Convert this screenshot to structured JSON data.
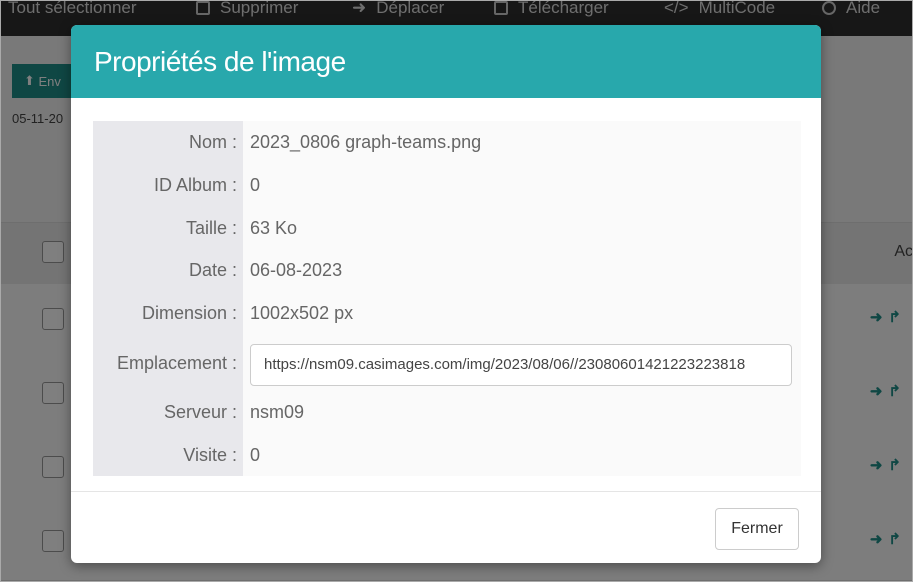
{
  "background": {
    "toolbar": [
      {
        "label": "Tout sélectionner",
        "icon": "check-square-icon"
      },
      {
        "label": "Supprimer",
        "icon": "trash-icon"
      },
      {
        "label": "Déplacer",
        "icon": "arrow-right-icon"
      },
      {
        "label": "Télécharger",
        "icon": "download-icon"
      },
      {
        "label": "MultiCode",
        "icon": "code-icon"
      },
      {
        "label": "Aide",
        "icon": "help-icon"
      }
    ],
    "upload_label": "Env",
    "date_text": "05-11-20",
    "actions_header": "Ac"
  },
  "modal": {
    "title": "Propriétés de l'image",
    "fields": {
      "nom": {
        "label": "Nom :",
        "value": "2023_0806 graph-teams.png"
      },
      "album": {
        "label": "ID Album :",
        "value": "0"
      },
      "taille": {
        "label": "Taille :",
        "value": "63 Ko"
      },
      "date": {
        "label": "Date :",
        "value": "06-08-2023"
      },
      "dimension": {
        "label": "Dimension :",
        "value": "1002x502 px"
      },
      "emplacement": {
        "label": "Emplacement :",
        "value": "https://nsm09.casimages.com/img/2023/08/06//23080601421223223818"
      },
      "serveur": {
        "label": "Serveur :",
        "value": "nsm09"
      },
      "visite": {
        "label": "Visite :",
        "value": "0"
      }
    },
    "close_label": "Fermer"
  },
  "colors": {
    "accent": "#28a8ac",
    "overlay": "rgba(0,0,0,0.5)"
  }
}
